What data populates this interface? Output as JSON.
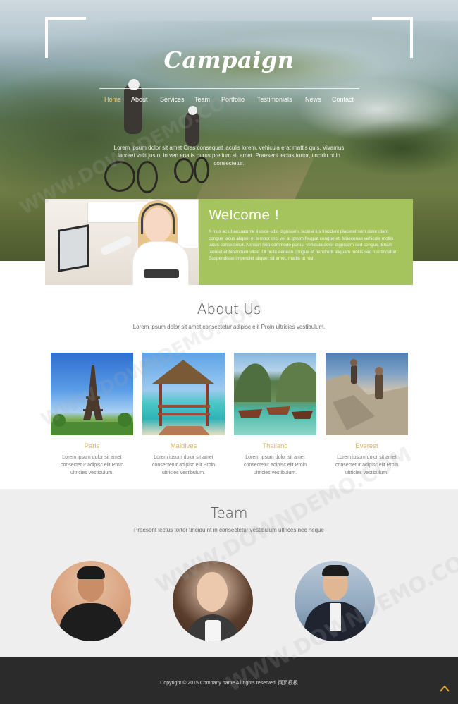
{
  "brand": {
    "logo": "Campaign"
  },
  "nav": {
    "items": [
      {
        "label": "Home",
        "active": true
      },
      {
        "label": "About",
        "active": false
      },
      {
        "label": "Services",
        "active": false
      },
      {
        "label": "Team",
        "active": false
      },
      {
        "label": "Portfolio",
        "active": false
      },
      {
        "label": "Testimonials",
        "active": false
      },
      {
        "label": "News",
        "active": false
      },
      {
        "label": "Contact",
        "active": false
      }
    ]
  },
  "hero": {
    "text": "Lorem ipsum dolor sit amet Cras consequat iaculis lorem, vehicula erat mattis quis. Vivamus laoreet velit justo, in ven enatis purus pretium sit amet. Praesent lectus tortor, tincidu nt in consectetur."
  },
  "welcome": {
    "title": "Welcome !",
    "text": "A mus ac ut arcuatume ti usce odio dignissim, lacinia ius tincidunt placerat sum dolor diam congue lacus aliquet et tempor orci vel at ipsum feugiat congue et. Maecenas vehicula mollis lacus consectetur. Aenean non commodo purus, vehicula dolor dignissim sed congue. Etiam laoreet et bibendum vitae. Ut nulla aenean congue et hendrerit aliquam mollis sed nisl tincidunt. Suspendisse imperdiet aliquet sit amet, mattis ut nisl."
  },
  "about": {
    "title": "About Us",
    "subtitle": "Lorem ipsum dolor sit amet consectetur adipisc elit Proin ultricies vestibulum.",
    "cards": [
      {
        "name": "Paris",
        "desc": "Lorem ipsum dolor sit amet consectetur adipisc elit Proin ultricies vestibulum."
      },
      {
        "name": "Maldives",
        "desc": "Lorem ipsum dolor sit amet consectetur adipisc elit Proin ultricies vestibulum."
      },
      {
        "name": "Thailand",
        "desc": "Lorem ipsum dolor sit amet consectetur adipisc elit Proin ultricies vestibulum."
      },
      {
        "name": "Everest",
        "desc": "Lorem ipsum dolor sit amet consectetur adipisc elit Proin ultricies vestibulum."
      }
    ]
  },
  "team": {
    "title": "Team",
    "subtitle": "Praesent lectus tortor tincidu nt in consectetur vestibulum ultrices nec neque"
  },
  "footer": {
    "copyright": "Copyright © 2015.Company name All rights reserved. 网页模板"
  },
  "watermark": {
    "text": "WWW.DOWNDEMO.COM"
  },
  "colors": {
    "accent_green": "#a6c45e",
    "accent_gold": "#d8b56a",
    "nav_active": "#f1d06a",
    "footer_bg": "#2b2b2b",
    "team_bg": "#eeeeee"
  }
}
